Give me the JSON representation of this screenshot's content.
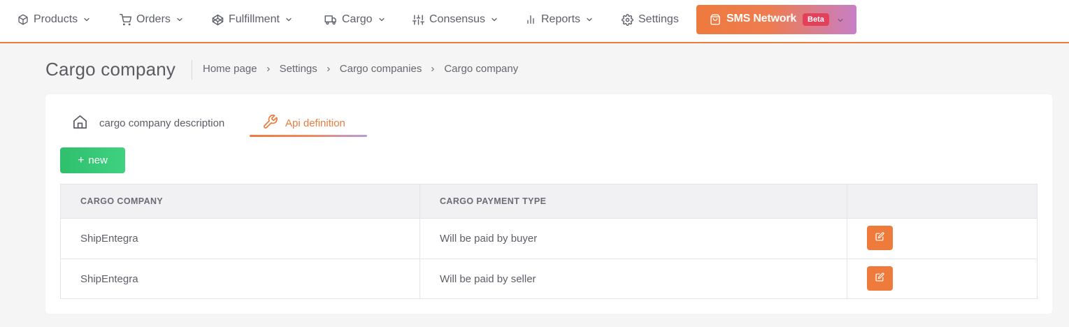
{
  "nav": {
    "items": [
      {
        "label": "Products",
        "icon": "box-icon"
      },
      {
        "label": "Orders",
        "icon": "cart-icon"
      },
      {
        "label": "Fulfillment",
        "icon": "codepen-icon"
      },
      {
        "label": "Cargo",
        "icon": "truck-icon"
      },
      {
        "label": "Consensus",
        "icon": "sliders-icon"
      },
      {
        "label": "Reports",
        "icon": "bar-chart-icon"
      },
      {
        "label": "Settings",
        "icon": "gear-icon"
      }
    ],
    "sms": {
      "label": "SMS Network",
      "badge": "Beta",
      "icon": "shopping-bag-icon"
    }
  },
  "page": {
    "title": "Cargo company",
    "breadcrumb": [
      "Home page",
      "Settings",
      "Cargo companies",
      "Cargo company"
    ]
  },
  "tabs": [
    {
      "label": "cargo company description",
      "icon": "home-icon",
      "active": false
    },
    {
      "label": "Api definition",
      "icon": "wrench-icon",
      "active": true
    }
  ],
  "actions": {
    "new_label": "new"
  },
  "table": {
    "headers": [
      "CARGO COMPANY",
      "CARGO PAYMENT TYPE",
      ""
    ],
    "rows": [
      {
        "company": "ShipEntegra",
        "payment_type": "Will be paid by buyer"
      },
      {
        "company": "ShipEntegra",
        "payment_type": "Will be paid by seller"
      }
    ]
  },
  "colors": {
    "accent": "#ee7a3c",
    "success": "#2fbf6d",
    "beta_badge": "#e4405a",
    "gradient_end": "#c77fc6"
  }
}
